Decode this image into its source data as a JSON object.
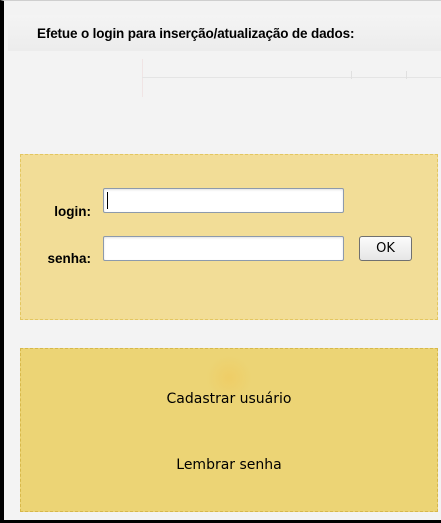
{
  "page": {
    "title": "Efetue o login para inserção/atualização de dados:"
  },
  "login_form": {
    "login_label": "login:",
    "login_value": "",
    "password_label": "senha:",
    "password_value": "",
    "submit_label": "OK"
  },
  "options": {
    "register_label": "Cadastrar usuário",
    "remind_password_label": "Lembrar senha"
  },
  "colors": {
    "login_panel_bg": "#f2dd97",
    "options_panel_bg": "#ecd475",
    "frame_border": "#000000"
  },
  "icons": {
    "options_watermark": "emblem-watermark-icon"
  }
}
